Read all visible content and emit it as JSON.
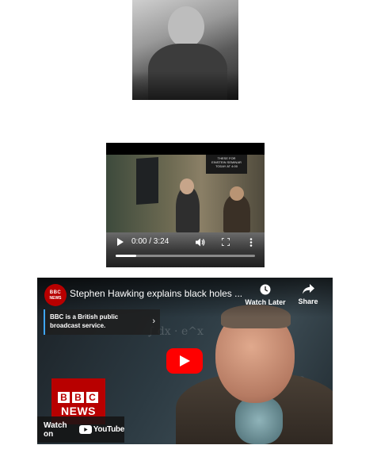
{
  "photo": {
    "alt": ""
  },
  "video_player": {
    "time_display": "0:00 / 3:24",
    "progress": 0.15,
    "icons": [
      "play-icon",
      "volume-icon",
      "fullscreen-icon",
      "more-vert-icon"
    ],
    "sign_text": "THESE FOR\nEINSTEIN SEMINAR\nTODAY AT 4:00"
  },
  "youtube_embed": {
    "channel_logo": {
      "top": "BBC",
      "bottom": "NEWS"
    },
    "title": "Stephen Hawking explains black holes ...",
    "watch_later_label": "Watch Later",
    "share_label": "Share",
    "info_card_text": "BBC is a British public broadcast service.",
    "watch_on_label": "Watch on",
    "youtube_wordmark": "YouTube",
    "thumbnail_logo": {
      "blocks": [
        "B",
        "B",
        "C"
      ],
      "word": "NEWS"
    },
    "colors": {
      "play_button": "#ff0000",
      "bbc_red": "#b80000",
      "info_accent": "#3ea6ff"
    }
  }
}
